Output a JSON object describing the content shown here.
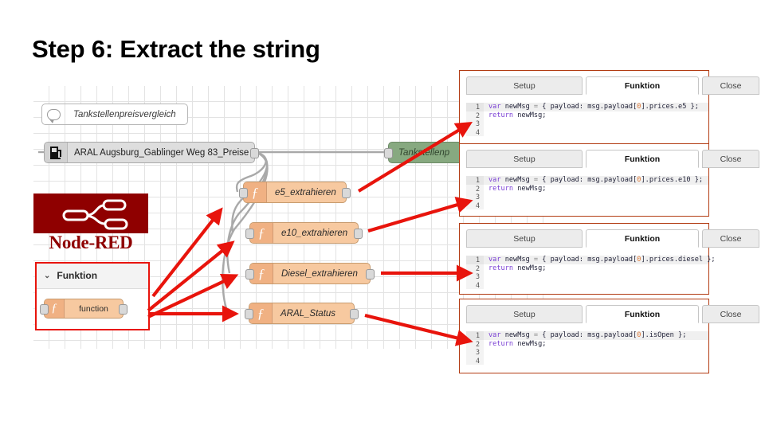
{
  "slide": {
    "title": "Step 6: Extract the string"
  },
  "branding": {
    "name": "Node-RED",
    "logo_color": "#8f0000",
    "accent_color": "#e8140c",
    "panel_border_color": "#b23b12"
  },
  "flow": {
    "comment_node": {
      "label": "Tankstellenpreisvergleich",
      "icon": "comment-bubble-icon"
    },
    "inject_node": {
      "label": "ARAL Augsburg_Gablinger Weg 83_Preise",
      "icon": "fuel-pump-icon"
    },
    "debug_node": {
      "label": "Tankstellenp",
      "icon": "debug-icon"
    },
    "function_nodes": [
      {
        "label": "e5_extrahieren",
        "icon": "function-icon"
      },
      {
        "label": "e10_extrahieren",
        "icon": "function-icon"
      },
      {
        "label": "Diesel_extrahieren",
        "icon": "function-icon"
      },
      {
        "label": "ARAL_Status",
        "icon": "function-icon"
      }
    ]
  },
  "palette": {
    "category_label": "Funktion",
    "chevron": "⌄",
    "node_label": "function"
  },
  "editor_panels": [
    {
      "tabs": {
        "setup": "Setup",
        "function": "Funktion",
        "close": "Close"
      },
      "active_tab": "Funktion",
      "highlighted_line": 1,
      "lines": [
        {
          "n": "1",
          "var": "var",
          "id": " newMsg",
          "op": " = ",
          "pre": "{ payload: msg.payload[",
          "num": "0",
          "post": "].prices.e5 };"
        },
        {
          "n": "2",
          "var": "return",
          "id": " newMsg;",
          "op": "",
          "pre": "",
          "num": "",
          "post": ""
        },
        {
          "n": "3",
          "var": "",
          "id": "",
          "op": "",
          "pre": "",
          "num": "",
          "post": ""
        },
        {
          "n": "4",
          "var": "",
          "id": "",
          "op": "",
          "pre": "",
          "num": "",
          "post": ""
        }
      ]
    },
    {
      "tabs": {
        "setup": "Setup",
        "function": "Funktion",
        "close": "Close"
      },
      "active_tab": "Funktion",
      "highlighted_line": 1,
      "lines": [
        {
          "n": "1",
          "var": "var",
          "id": " newMsg",
          "op": " = ",
          "pre": "{ payload: msg.payload[",
          "num": "0",
          "post": "].prices.e10 };"
        },
        {
          "n": "2",
          "var": "return",
          "id": " newMsg;",
          "op": "",
          "pre": "",
          "num": "",
          "post": ""
        },
        {
          "n": "3",
          "var": "",
          "id": "",
          "op": "",
          "pre": "",
          "num": "",
          "post": ""
        },
        {
          "n": "4",
          "var": "",
          "id": "",
          "op": "",
          "pre": "",
          "num": "",
          "post": ""
        }
      ]
    },
    {
      "tabs": {
        "setup": "Setup",
        "function": "Funktion",
        "close": "Close"
      },
      "active_tab": "Funktion",
      "highlighted_line": 1,
      "lines": [
        {
          "n": "1",
          "var": "var",
          "id": " newMsg",
          "op": " = ",
          "pre": "{ payload: msg.payload[",
          "num": "0",
          "post": "].prices.diesel };"
        },
        {
          "n": "2",
          "var": "return",
          "id": " newMsg;",
          "op": "",
          "pre": "",
          "num": "",
          "post": ""
        },
        {
          "n": "3",
          "var": "",
          "id": "",
          "op": "",
          "pre": "",
          "num": "",
          "post": ""
        },
        {
          "n": "4",
          "var": "",
          "id": "",
          "op": "",
          "pre": "",
          "num": "",
          "post": ""
        }
      ]
    },
    {
      "tabs": {
        "setup": "Setup",
        "function": "Funktion",
        "close": "Close"
      },
      "active_tab": "Funktion",
      "highlighted_line": 1,
      "lines": [
        {
          "n": "1",
          "var": "var",
          "id": " newMsg",
          "op": " = ",
          "pre": "{ payload: msg.payload[",
          "num": "0",
          "post": "].isOpen };"
        },
        {
          "n": "2",
          "var": "return",
          "id": " newMsg;",
          "op": "",
          "pre": "",
          "num": "",
          "post": ""
        },
        {
          "n": "3",
          "var": "",
          "id": "",
          "op": "",
          "pre": "",
          "num": "",
          "post": ""
        },
        {
          "n": "4",
          "var": "",
          "id": "",
          "op": "",
          "pre": "",
          "num": "",
          "post": ""
        }
      ]
    }
  ]
}
